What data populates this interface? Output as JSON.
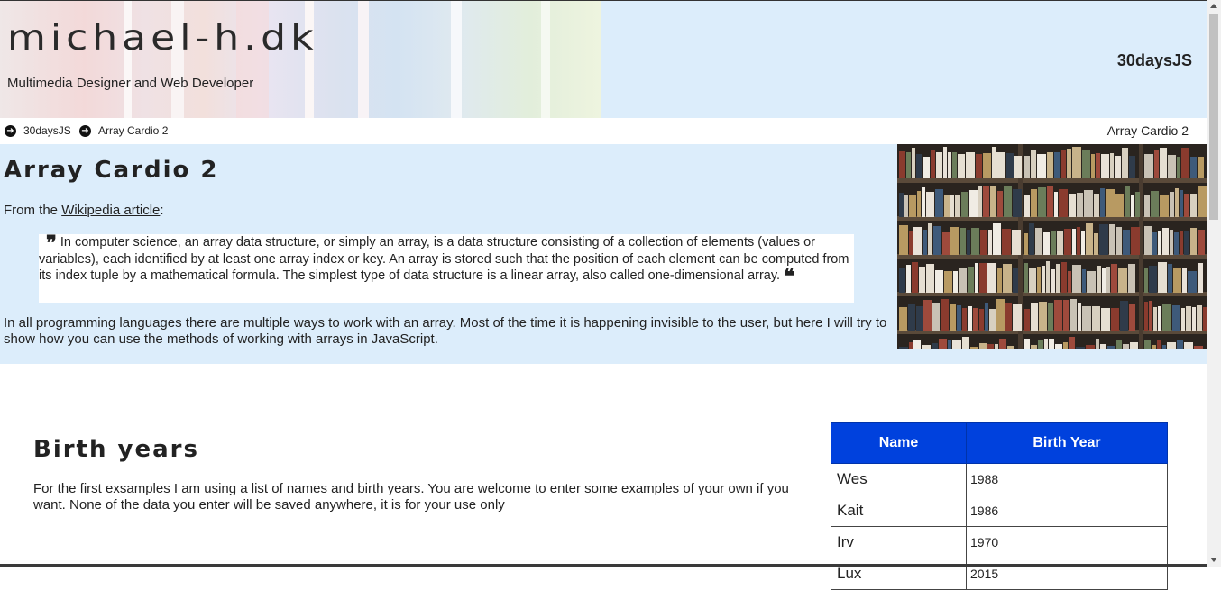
{
  "header": {
    "site_title": "michael-h.dk",
    "subtitle": "Multimedia Designer and Web Developer",
    "nav_link": "30daysJS"
  },
  "breadcrumb": {
    "items": [
      {
        "label": "30daysJS",
        "icon": "arrow-circle-right-icon"
      },
      {
        "label": "Array Cardio 2",
        "icon": "arrow-circle-right-icon"
      }
    ],
    "current_page": "Array Cardio 2"
  },
  "intro": {
    "title": "Array Cardio 2",
    "from_prefix": "From the ",
    "from_link": "Wikipedia article",
    "from_suffix": ":",
    "quote": "In computer science, an array data structure, or simply an array, is a data structure consisting of a collection of elements (values or variables), each identified by at least one array index or key. An array is stored such that the position of each element can be computed from its index tuple by a mathematical formula. The simplest type of data structure is a linear array, also called one-dimensional array.",
    "paragraph": "In all programming languages there are multiple ways to work with an array. Most of the time it is happening invisible to the user, but here I will try to show how you can use the methods of working with arrays in JavaScript."
  },
  "birth": {
    "title": "Birth years",
    "paragraph": "For the first exsamples I am using a list of names and birth years. You are welcome to enter some examples of your own if you want. None of the data you enter will be saved anywhere, it is for your use only",
    "table": {
      "headers": [
        "Name",
        "Birth Year"
      ],
      "rows": [
        {
          "name": "Wes",
          "year": "1988"
        },
        {
          "name": "Kait",
          "year": "1986"
        },
        {
          "name": "Irv",
          "year": "1970"
        },
        {
          "name": "Lux",
          "year": "2015"
        }
      ]
    }
  },
  "colors": {
    "header_bg": "#dcedfb",
    "table_header_bg": "#0041dd"
  }
}
